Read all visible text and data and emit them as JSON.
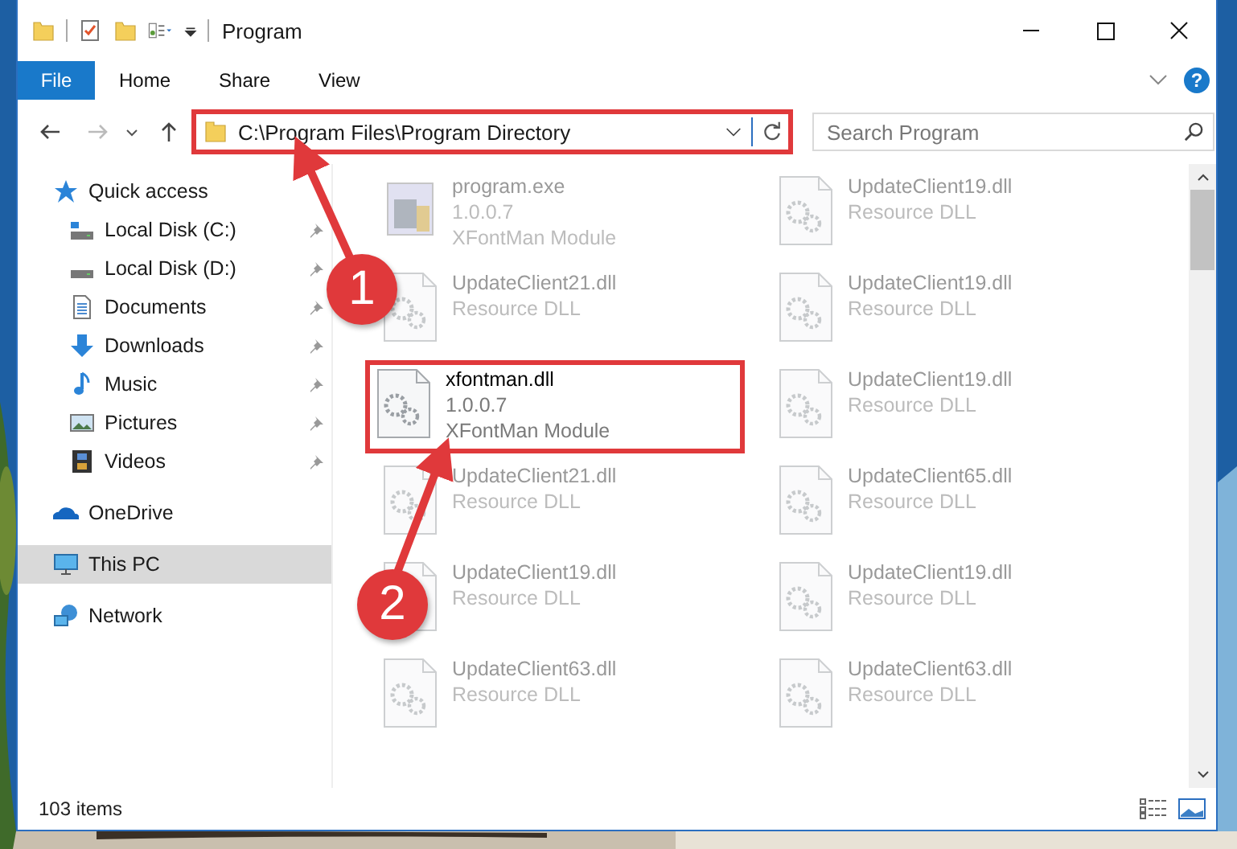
{
  "window": {
    "title": "Program"
  },
  "ribbon": {
    "tabs": [
      {
        "label": "File",
        "selected": true
      },
      {
        "label": "Home",
        "selected": false
      },
      {
        "label": "Share",
        "selected": false
      },
      {
        "label": "View",
        "selected": false
      }
    ],
    "help": "?"
  },
  "address_bar": {
    "path": "C:\\Program Files\\Program Directory",
    "highlighted": true
  },
  "search": {
    "placeholder": "Search Program"
  },
  "sidebar": {
    "items": [
      {
        "label": "Quick access",
        "kind": "star",
        "selected": false,
        "children": [
          {
            "label": "Local Disk (C:)",
            "kind": "drive-c",
            "selected": false,
            "pinned": true
          },
          {
            "label": "Local Disk (D:)",
            "kind": "drive",
            "selected": false,
            "pinned": true
          },
          {
            "label": "Documents",
            "kind": "documents",
            "selected": false,
            "pinned": true
          },
          {
            "label": "Downloads",
            "kind": "downloads",
            "selected": false,
            "pinned": true
          },
          {
            "label": "Music",
            "kind": "music",
            "selected": false,
            "pinned": true
          },
          {
            "label": "Pictures",
            "kind": "pictures",
            "selected": false,
            "pinned": true
          },
          {
            "label": "Videos",
            "kind": "videos",
            "selected": false,
            "pinned": true
          }
        ]
      },
      {
        "label": "OneDrive",
        "kind": "cloud",
        "selected": false
      },
      {
        "label": "This PC",
        "kind": "pc",
        "selected": true
      },
      {
        "label": "Network",
        "kind": "network",
        "selected": false
      }
    ]
  },
  "files": [
    {
      "name": "program.exe",
      "lines": [
        "1.0.0.7",
        "XFontMan Module"
      ],
      "kind": "exe",
      "blurred": true,
      "highlighted": false
    },
    {
      "name": "UpdateClient19.dll",
      "lines": [
        "Resource DLL"
      ],
      "kind": "dll",
      "blurred": true,
      "highlighted": false
    },
    {
      "name": "UpdateClient21.dll",
      "lines": [
        "Resource DLL"
      ],
      "kind": "dll",
      "blurred": true,
      "highlighted": false
    },
    {
      "name": "UpdateClient19.dll",
      "lines": [
        "Resource DLL"
      ],
      "kind": "dll",
      "blurred": true,
      "highlighted": false
    },
    {
      "name": "xfontman.dll",
      "lines": [
        "1.0.0.7",
        "XFontMan Module"
      ],
      "kind": "dll",
      "blurred": false,
      "highlighted": true
    },
    {
      "name": "UpdateClient19.dll",
      "lines": [
        "Resource DLL"
      ],
      "kind": "dll",
      "blurred": true,
      "highlighted": false
    },
    {
      "name": "UpdateClient21.dll",
      "lines": [
        "Resource DLL"
      ],
      "kind": "dll",
      "blurred": true,
      "highlighted": false
    },
    {
      "name": "UpdateClient65.dll",
      "lines": [
        "Resource DLL"
      ],
      "kind": "dll",
      "blurred": true,
      "highlighted": false
    },
    {
      "name": "UpdateClient19.dll",
      "lines": [
        "Resource DLL"
      ],
      "kind": "dll",
      "blurred": true,
      "highlighted": false
    },
    {
      "name": "UpdateClient19.dll",
      "lines": [
        "Resource DLL"
      ],
      "kind": "dll",
      "blurred": true,
      "highlighted": false
    },
    {
      "name": "UpdateClient63.dll",
      "lines": [
        "Resource DLL"
      ],
      "kind": "dll",
      "blurred": true,
      "highlighted": false
    },
    {
      "name": "UpdateClient63.dll",
      "lines": [
        "Resource DLL"
      ],
      "kind": "dll",
      "blurred": true,
      "highlighted": false
    }
  ],
  "status_bar": {
    "count": "103 items"
  },
  "annotations": [
    {
      "number": "1"
    },
    {
      "number": "2"
    }
  ]
}
